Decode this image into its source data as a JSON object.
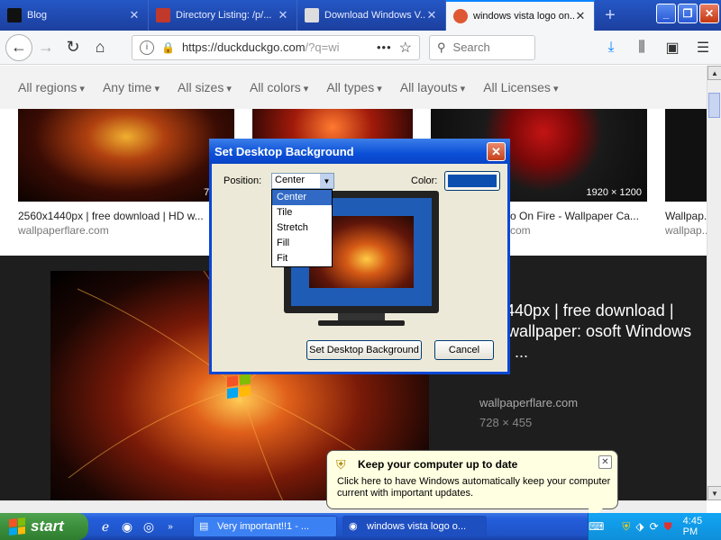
{
  "browser": {
    "tabs": [
      {
        "title": "Blog",
        "fav_color": "#111111"
      },
      {
        "title": "Directory Listing: /p/...",
        "fav_color": "#c0392b"
      },
      {
        "title": "Download Windows V...",
        "fav_color": "#555555"
      },
      {
        "title": "windows vista logo on...",
        "fav_color": "#de5833"
      }
    ],
    "url_main": "https://duckduckgo.com",
    "url_rest": "/?q=wi",
    "search_placeholder": "Search",
    "menu_dots": "•••"
  },
  "filters": [
    "All regions",
    "Any time",
    "All sizes",
    "All colors",
    "All types",
    "All layouts",
    "All Licenses"
  ],
  "results": {
    "items": [
      {
        "caption": "2560x1440px | free download | HD w...",
        "source": "wallpaperflare.com",
        "size": "728 ×"
      },
      {
        "caption": "",
        "source": "",
        "size": ""
      },
      {
        "caption": "o On Fire - Wallpaper Ca...",
        "source": "com",
        "size": "1920 × 1200"
      },
      {
        "caption": "Wallpap...",
        "source": "wallpap...",
        "size": ""
      }
    ],
    "detail": {
      "title": "0x1440px | free download | HD wallpaper: osoft Windows logo ...",
      "source": "wallpaperflare.com",
      "dimensions": "728 × 455"
    }
  },
  "dialog": {
    "title": "Set Desktop Background",
    "position_label": "Position:",
    "position_value": "Center",
    "color_label": "Color:",
    "color_value": "#0a4fb0",
    "options": [
      "Center",
      "Tile",
      "Stretch",
      "Fill",
      "Fit"
    ],
    "selected_option": "Center",
    "set_button": "Set Desktop Background",
    "cancel_button": "Cancel"
  },
  "balloon": {
    "title": "Keep your computer up to date",
    "text": "Click here to have Windows automatically keep your computer current with important updates."
  },
  "taskbar": {
    "start_label": "start",
    "tasks": [
      {
        "label": "Very important!!1 - ...",
        "active": false
      },
      {
        "label": "windows vista logo o...",
        "active": true
      }
    ],
    "clock": "4:45 PM"
  }
}
